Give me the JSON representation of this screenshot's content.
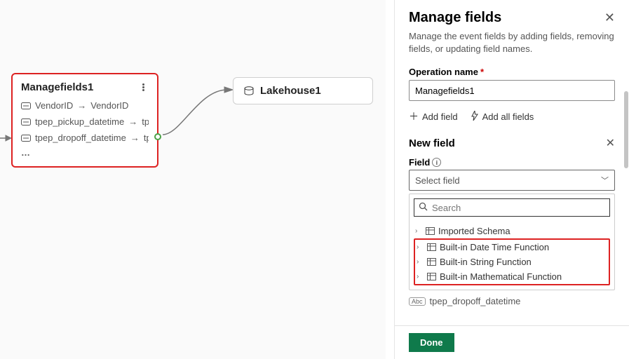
{
  "canvas": {
    "node1": {
      "title": "Managefields1",
      "rows": [
        {
          "from": "VendorID",
          "to": "VendorID"
        },
        {
          "from": "tpep_pickup_datetime",
          "to": "tpe"
        },
        {
          "from": "tpep_dropoff_datetime",
          "to": "tp"
        }
      ],
      "more": "…"
    },
    "node2": {
      "title": "Lakehouse1"
    }
  },
  "panel": {
    "title": "Manage fields",
    "subtitle": "Manage the event fields by adding fields, removing fields, or updating field names.",
    "op_label": "Operation name",
    "op_value": "Managefields1",
    "add_field": "Add field",
    "add_all": "Add all fields",
    "newfield_title": "New field",
    "field_label": "Field",
    "select_placeholder": "Select field",
    "search_placeholder": "Search",
    "tree": {
      "imported": "Imported Schema",
      "dt": "Built-in Date Time Function",
      "str": "Built-in String Function",
      "math": "Built-in Mathematical Function"
    },
    "chip_value": "tpep_dropoff_datetime",
    "done": "Done"
  }
}
